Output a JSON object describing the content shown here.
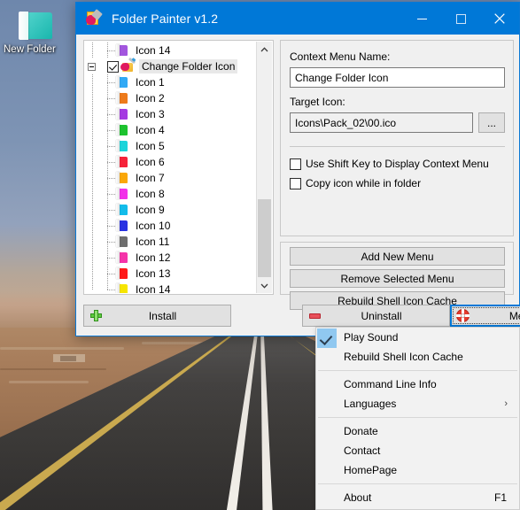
{
  "desktop": {
    "icon": {
      "label": "New Folder",
      "icon": "folder-icon",
      "color": "#19b6ad"
    },
    "wallpaper": "desert-road"
  },
  "window": {
    "title": "Folder Painter v1.2",
    "icon": "app-paint-folder-icon",
    "titlebar_color": "#0078d7",
    "controls": {
      "minimize": "minimize-icon",
      "maximize": "maximize-icon",
      "close": "close-icon"
    }
  },
  "tree": {
    "items": [
      {
        "label": "Icon 14",
        "color": "#9b59d0",
        "level": 2,
        "kind": "icon",
        "partial": true
      },
      {
        "label": "Change Folder Icon",
        "color": "#f0b429",
        "level": 1,
        "kind": "menu",
        "checked": true,
        "selected": true,
        "expanded": true
      },
      {
        "label": "Icon 1",
        "color": "#3ea6e8",
        "level": 2,
        "kind": "icon"
      },
      {
        "label": "Icon 2",
        "color": "#e07c2a",
        "level": 2,
        "kind": "icon"
      },
      {
        "label": "Icon 3",
        "color": "#9b3fd0",
        "level": 2,
        "kind": "icon"
      },
      {
        "label": "Icon 4",
        "color": "#2dbd3c",
        "level": 2,
        "kind": "icon"
      },
      {
        "label": "Icon 5",
        "color": "#2ecfd4",
        "level": 2,
        "kind": "icon"
      },
      {
        "label": "Icon 6",
        "color": "#e0283c",
        "level": 2,
        "kind": "icon"
      },
      {
        "label": "Icon 7",
        "color": "#f0a81e",
        "level": 2,
        "kind": "icon"
      },
      {
        "label": "Icon 8",
        "color": "#e036d8",
        "level": 2,
        "kind": "icon"
      },
      {
        "label": "Icon 9",
        "color": "#24b8e0",
        "level": 2,
        "kind": "icon"
      },
      {
        "label": "Icon 10",
        "color": "#2b33cc",
        "level": 2,
        "kind": "icon"
      },
      {
        "label": "Icon 11",
        "color": "#6e6e6e",
        "level": 2,
        "kind": "icon"
      },
      {
        "label": "Icon 12",
        "color": "#e23aa0",
        "level": 2,
        "kind": "icon"
      },
      {
        "label": "Icon 13",
        "color": "#f02020",
        "level": 2,
        "kind": "icon"
      },
      {
        "label": "Icon 14",
        "color": "#f2e318",
        "level": 2,
        "kind": "icon"
      }
    ],
    "scrollbar": {
      "up": "chevron-up-icon",
      "down": "chevron-down-icon"
    }
  },
  "details": {
    "context_menu_name_label": "Context Menu Name:",
    "context_menu_name_value": "Change Folder Icon",
    "target_icon_label": "Target Icon:",
    "target_icon_value": "Icons\\Pack_02\\00.ico",
    "browse_label": "...",
    "checkbox_shift": {
      "label": "Use Shift Key to Display Context Menu",
      "checked": false
    },
    "checkbox_copy": {
      "label": "Copy icon while in folder",
      "checked": false
    }
  },
  "actions": {
    "add_new_menu": "Add New Menu",
    "remove_selected_menu": "Remove Selected Menu",
    "rebuild_shell_icon_cache": "Rebuild Shell Icon Cache"
  },
  "footer": {
    "install": {
      "label": "Install",
      "icon": "plus-icon"
    },
    "uninstall": {
      "label": "Uninstall",
      "icon": "minus-icon"
    },
    "menu": {
      "label": "Menu ...",
      "icon": "lifebuoy-icon",
      "focused": true
    }
  },
  "context_menu": {
    "items": [
      {
        "label": "Play Sound",
        "checked": true
      },
      {
        "label": "Rebuild Shell Icon Cache"
      },
      {
        "separator": true
      },
      {
        "label": "Command Line Info"
      },
      {
        "label": "Languages",
        "submenu": true,
        "arrow": "›"
      },
      {
        "separator": true
      },
      {
        "label": "Donate"
      },
      {
        "label": "Contact"
      },
      {
        "label": "HomePage"
      },
      {
        "separator": true
      },
      {
        "label": "About",
        "accel": "F1"
      }
    ]
  }
}
